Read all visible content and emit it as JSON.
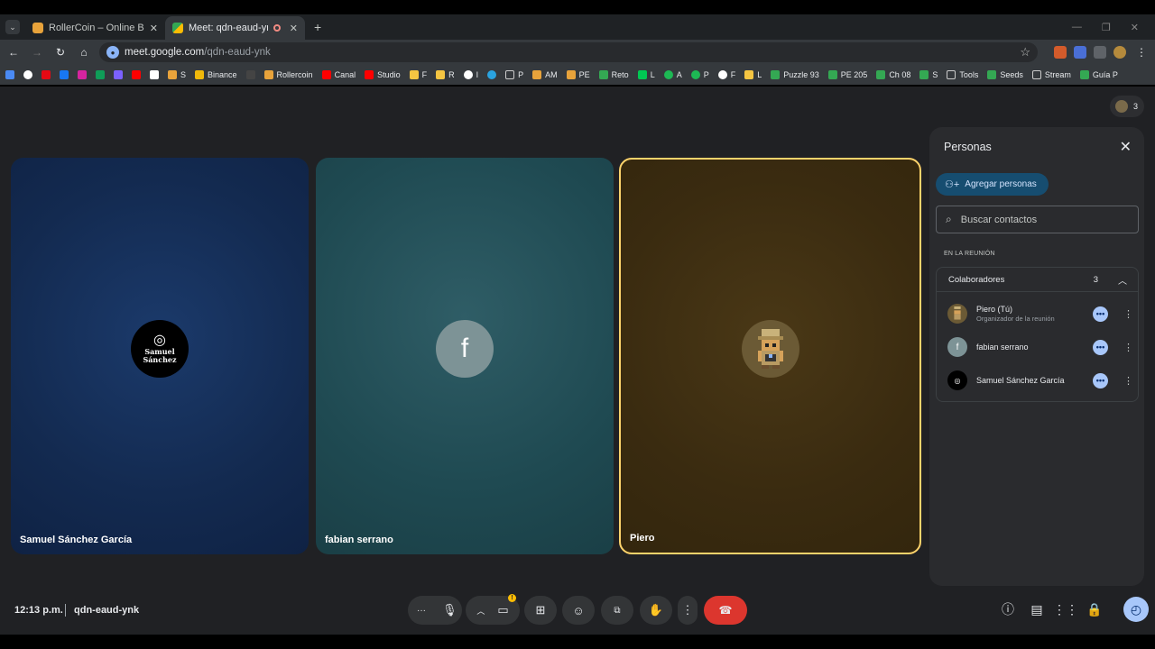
{
  "browser": {
    "tabs": [
      {
        "title": "RollerCoin – Online Bitcoin Mini",
        "active": false
      },
      {
        "title": "Meet: qdn-eaud-ynk",
        "active": true
      }
    ],
    "url_host": "meet.google.com",
    "url_path": "/qdn-eaud-ynk",
    "bookmarks": [
      "S",
      "Binance",
      "Rollercoin",
      "Canal",
      "Studio",
      "F",
      "R",
      "I",
      "P",
      "AM",
      "PE",
      "Reto",
      "L",
      "A",
      "P",
      "F",
      "L",
      "Puzzle 93",
      "PE 205",
      "Ch 08",
      "S",
      "Tools",
      "Seeds",
      "Stream",
      "Guía P"
    ]
  },
  "meeting": {
    "tiles": [
      {
        "name": "Samuel Sánchez García",
        "avatar_text": "Samuel Sánchez"
      },
      {
        "name": "fabian serrano",
        "avatar_text": "f"
      },
      {
        "name": "Piero",
        "avatar_text": ""
      }
    ],
    "participant_count": "3",
    "time": "12:13 p.m.",
    "code": "qdn-eaud-ynk"
  },
  "panel": {
    "title": "Personas",
    "add_label": "Agregar personas",
    "search_placeholder": "Buscar contactos",
    "section_label": "EN LA REUNIÓN",
    "group_label": "Colaboradores",
    "group_count": "3",
    "people": [
      {
        "name": "Piero (Tú)",
        "subtitle": "Organizador de la reunión",
        "avatar": ""
      },
      {
        "name": "fabian serrano",
        "subtitle": "",
        "avatar": "f"
      },
      {
        "name": "Samuel Sánchez García",
        "subtitle": "",
        "avatar": ""
      }
    ]
  },
  "colors": {
    "accent": "#a8c7fa",
    "end_call": "#dc362e",
    "speaker_border": "#fdd36b"
  }
}
